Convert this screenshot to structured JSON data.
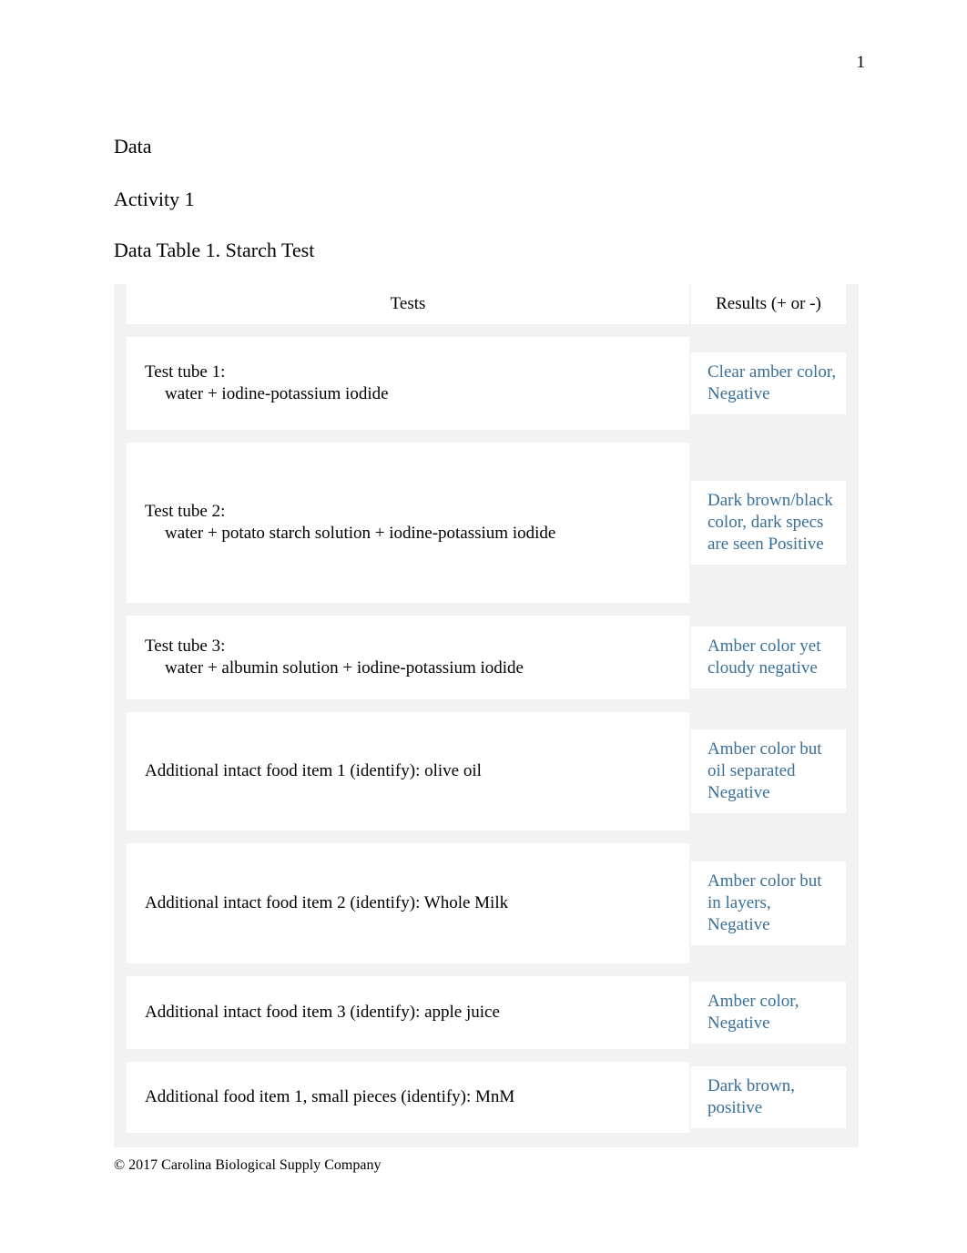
{
  "page": {
    "number": "1",
    "footer": "© 2017 Carolina Biological Supply Company"
  },
  "headings": {
    "data": "Data",
    "activity": "Activity 1",
    "table_title": "Data Table 1. Starch Test"
  },
  "table": {
    "headers": {
      "tests": "Tests",
      "results": "Results (+ or -)"
    },
    "rows": [
      {
        "test_line1": "Test tube 1:",
        "test_line2": "water + iodine-potassium iodide",
        "result": "Clear amber color, Negative"
      },
      {
        "test_line1": "Test tube 2:",
        "test_line2": "water + potato starch solution + iodine-potassium iodide",
        "result": "Dark brown/black color, dark specs are seen Positive"
      },
      {
        "test_line1": "Test tube 3:",
        "test_line2": "water + albumin solution + iodine-potassium iodide",
        "result": "Amber color yet cloudy negative"
      },
      {
        "test_line1": "Additional intact food item 1 (identify): olive oil",
        "test_line2": "",
        "result": "Amber color but oil separated Negative"
      },
      {
        "test_line1": "Additional intact food item 2 (identify): Whole Milk",
        "test_line2": "",
        "result": "Amber color but in layers, Negative"
      },
      {
        "test_line1": "Additional intact food item 3 (identify): apple juice",
        "test_line2": "",
        "result": "Amber color, Negative"
      },
      {
        "test_line1": "Additional food item 1, small pieces (identify): MnM",
        "test_line2": "",
        "result": "Dark brown, positive"
      }
    ]
  }
}
